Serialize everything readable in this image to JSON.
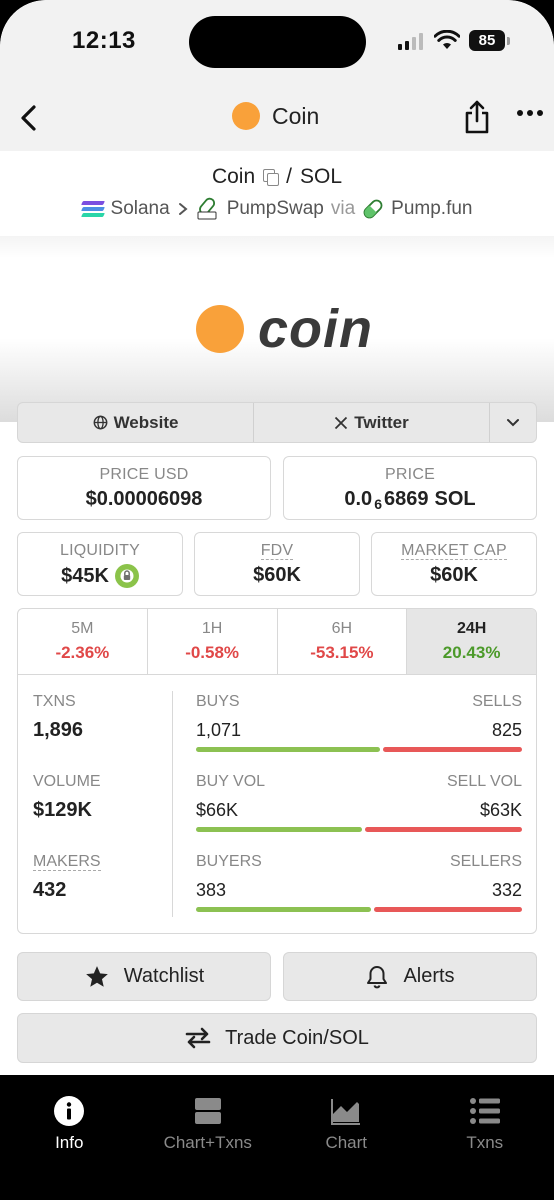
{
  "status_bar": {
    "time": "12:13",
    "battery": "85"
  },
  "header": {
    "title": "Coin"
  },
  "pair": {
    "base": "Coin",
    "separator": "/",
    "quote": "SOL",
    "chain": "Solana",
    "dex": "PumpSwap",
    "via": "via",
    "launchpad": "Pump.fun"
  },
  "banner": {
    "wordmark": "coin"
  },
  "links": {
    "website": "Website",
    "twitter": "Twitter"
  },
  "stats": {
    "price_usd_label": "PRICE USD",
    "price_usd": "$0.00006098",
    "price_label": "PRICE",
    "price_prefix": "0.0",
    "price_zeros": "6",
    "price_digits": "6869",
    "price_unit": "SOL",
    "liquidity_label": "LIQUIDITY",
    "liquidity": "$45K",
    "fdv_label": "FDV",
    "fdv": "$60K",
    "mcap_label": "MARKET CAP",
    "mcap": "$60K"
  },
  "timeframes": [
    {
      "label": "5M",
      "change": "-2.36%"
    },
    {
      "label": "1H",
      "change": "-0.58%"
    },
    {
      "label": "6H",
      "change": "-53.15%"
    },
    {
      "label": "24H",
      "change": "20.43%"
    }
  ],
  "metrics": {
    "txns_label": "TXNS",
    "txns": "1,896",
    "volume_label": "VOLUME",
    "volume": "$129K",
    "makers_label": "MAKERS",
    "makers": "432"
  },
  "splits": {
    "buys_label": "BUYS",
    "buys": "1,071",
    "sells_label": "SELLS",
    "sells": "825",
    "buys_fraction": 0.565,
    "buyvol_label": "BUY VOL",
    "buyvol": "$66K",
    "sellvol_label": "SELL VOL",
    "sellvol": "$63K",
    "buyvol_fraction": 0.51,
    "buyers_label": "BUYERS",
    "buyers": "383",
    "sellers_label": "SELLERS",
    "sellers": "332",
    "buyers_fraction": 0.536
  },
  "actions": {
    "watchlist": "Watchlist",
    "alerts": "Alerts",
    "trade": "Trade Coin/SOL"
  },
  "tabbar": {
    "info": "Info",
    "chart_txns": "Chart+Txns",
    "chart": "Chart",
    "txns": "Txns"
  },
  "colors": {
    "accent_orange": "#f9a13a",
    "positive": "#4c9a2a",
    "negative": "#e04848",
    "buy_bar": "#8cc152",
    "sell_bar": "#e85858"
  }
}
